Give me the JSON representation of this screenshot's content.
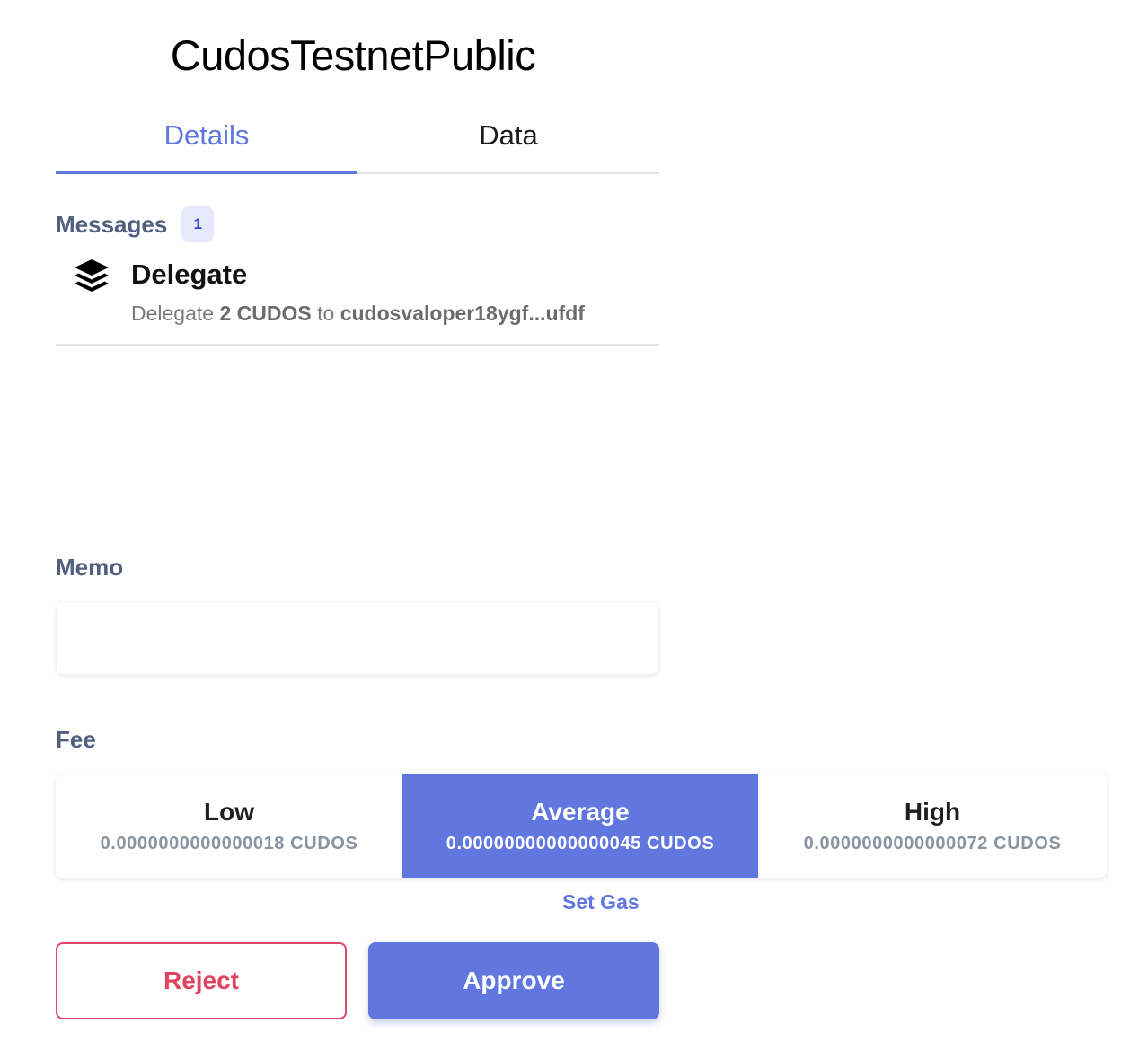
{
  "header": {
    "title": "CudosTestnetPublic"
  },
  "tabs": [
    {
      "label": "Details",
      "active": true
    },
    {
      "label": "Data",
      "active": false
    }
  ],
  "messages": {
    "label": "Messages",
    "count": "1",
    "items": [
      {
        "icon": "layers-icon",
        "title": "Delegate",
        "desc_prefix": "Delegate",
        "amount": "2 CUDOS",
        "desc_mid": "to",
        "validator": "cudosvaloper18ygf...ufdf"
      }
    ]
  },
  "memo": {
    "label": "Memo",
    "value": "",
    "placeholder": ""
  },
  "fee": {
    "label": "Fee",
    "selected": "Average",
    "options": [
      {
        "name": "Low",
        "amount": "0.0000000000000018 CUDOS"
      },
      {
        "name": "Average",
        "amount": "0.00000000000000045 CUDOS"
      },
      {
        "name": "High",
        "amount": "0.0000000000000072 CUDOS"
      }
    ]
  },
  "actions": {
    "set_gas": "Set Gas",
    "reject": "Reject",
    "approve": "Approve"
  },
  "colors": {
    "accent": "#5f77df",
    "reject": "#e0435f",
    "label": "#525f7f"
  }
}
